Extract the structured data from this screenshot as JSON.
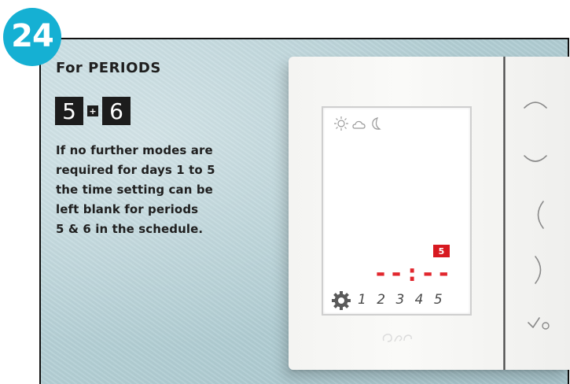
{
  "step_badge": "24",
  "heading": "For PERIODS",
  "periods": {
    "first": "5",
    "joiner": "+",
    "second": "6"
  },
  "description_lines": [
    "If no further modes are",
    "required for days 1 to 5",
    "the time setting can be",
    "left blank for periods",
    "5 & 6 in the schedule."
  ],
  "display": {
    "mode_icons": [
      "sun-icon",
      "cloud-icon",
      "moon-icon"
    ],
    "period_badge": "5",
    "time_value": "--:--",
    "days": "1 2 3 4 5"
  },
  "buttons": [
    "up-chevron-button",
    "down-chevron-button",
    "left-chevron-button",
    "right-chevron-button",
    "confirm-button"
  ],
  "colors": {
    "badge": "#15b0d3",
    "accent_red": "#d71920",
    "panel_bg": "#b5d0d6",
    "device": "#f6f6f4"
  }
}
